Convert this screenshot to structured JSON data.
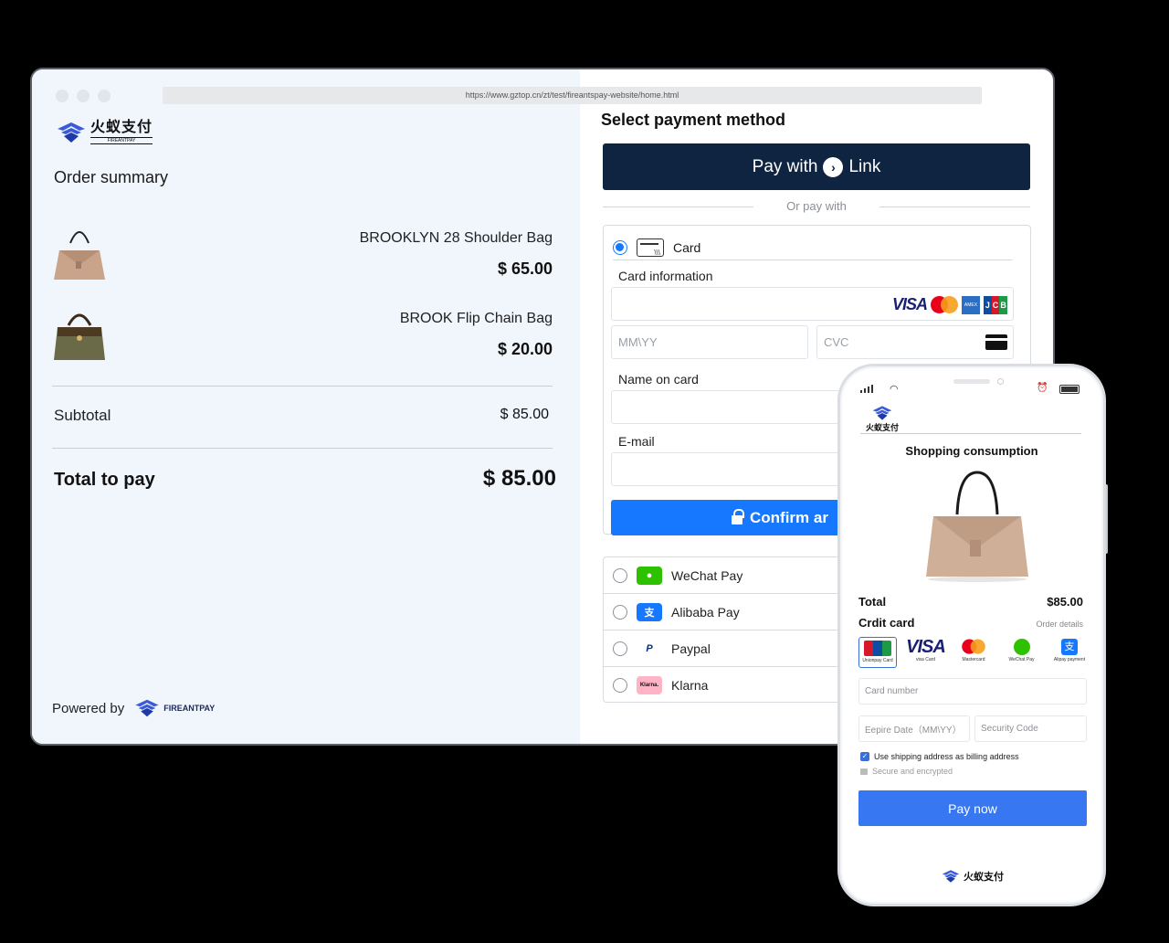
{
  "browser": {
    "url": "https://www.gztop.cn/zt/test/fireantspay-website/home.html",
    "brand_cn": "火蚁支付",
    "brand_en": "FIREANTPAY"
  },
  "order": {
    "title": "Order summary",
    "items": [
      {
        "name": "BROOKLYN 28 Shoulder Bag",
        "price": "$ 65.00"
      },
      {
        "name": "BROOK Flip Chain Bag",
        "price": "$ 20.00"
      }
    ],
    "subtotal_label": "Subtotal",
    "subtotal_value": "$ 85.00",
    "total_label": "Total to pay",
    "total_value": "$ 85.00",
    "powered_by": "Powered by",
    "powered_brand": "FIREANTPAY"
  },
  "payment": {
    "title": "Select payment method",
    "link_button_prefix": "Pay with",
    "link_button_suffix": "Link",
    "or_pay_with": "Or pay with",
    "card_option": "Card",
    "card_info_label": "Card information",
    "expiry_placeholder": "MM\\YY",
    "cvc_placeholder": "CVC",
    "name_label": "Name on card",
    "email_label": "E-mail",
    "confirm_label": "Confirm ar",
    "alternatives": [
      {
        "label": "WeChat Pay",
        "icon": "wechat-icon",
        "color": "#2dc100"
      },
      {
        "label": "Alibaba Pay",
        "icon": "alipay-icon",
        "color": "#1677ff"
      },
      {
        "label": "Paypal",
        "icon": "paypal-icon",
        "color": "#003087"
      },
      {
        "label": "Klarna",
        "icon": "klarna-icon",
        "color": "#ffb3c7"
      }
    ]
  },
  "phone": {
    "brand_cn": "火蚁支付",
    "title": "Shopping consumption",
    "total_label": "Total",
    "total_value": "$85.00",
    "credit_label": "Crdit card",
    "order_details": "Order details",
    "cards": [
      {
        "label": "Unionpay Card"
      },
      {
        "label": "visa Card"
      },
      {
        "label": "Mastercard"
      },
      {
        "label": "WeChat Pay"
      },
      {
        "label": "Alipay payment"
      }
    ],
    "card_number_placeholder": "Card number",
    "expiry_placeholder": "Eepire Date（MM\\YY）",
    "security_placeholder": "Security Code",
    "billing_checkbox": "Use shipping address as billing address",
    "secure_text": "Secure and encrypted",
    "pay_button": "Pay now",
    "footer_brand": "火蚁支付"
  },
  "colors": {
    "accent": "#1677ff",
    "link_button": "#0e2440",
    "phone_pay": "#3877f2"
  }
}
